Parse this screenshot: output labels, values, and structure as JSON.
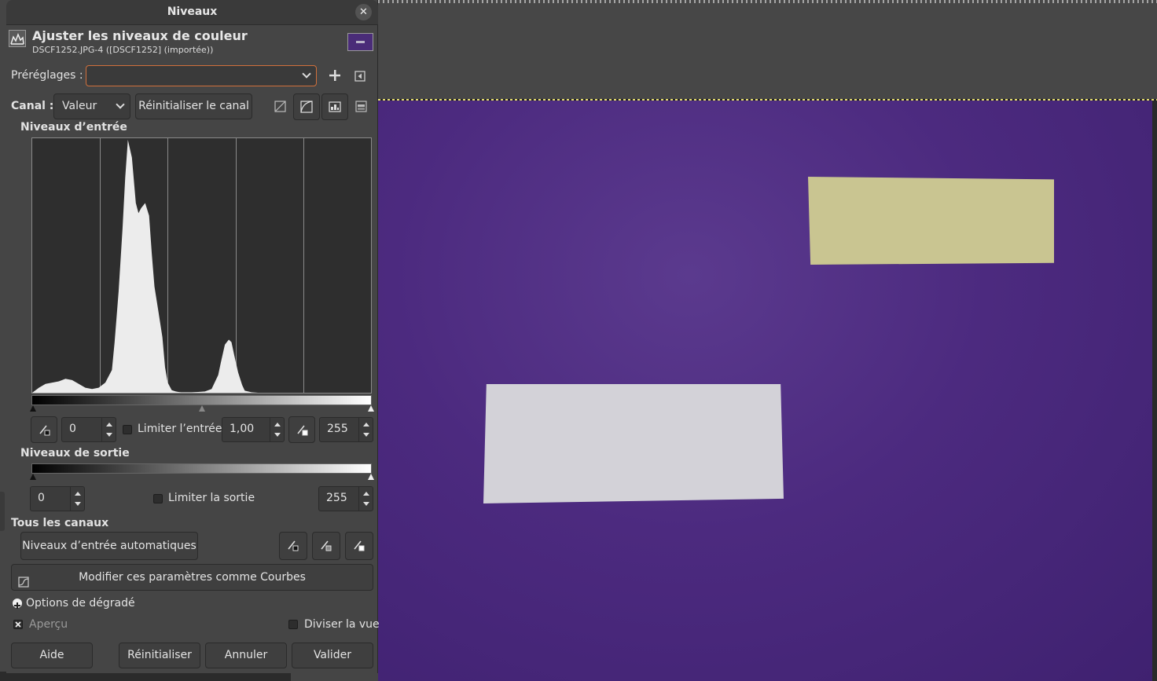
{
  "dialog": {
    "window_title": "Niveaux",
    "header_title": "Ajuster les niveaux de couleur",
    "header_subtitle": "DSCF1252.JPG-4 ([DSCF1252] (importée))"
  },
  "presets": {
    "label": "Préréglages :",
    "value": ""
  },
  "channel": {
    "label": "Canal :",
    "value": "Valeur",
    "reset_label": "Réinitialiser le canal"
  },
  "input_levels": {
    "title": "Niveaux d’entrée",
    "low": "0",
    "gamma": "1,00",
    "high": "255",
    "clamp_label": "Limiter l’entrée"
  },
  "output_levels": {
    "title": "Niveaux de sortie",
    "low": "0",
    "high": "255",
    "clamp_label": "Limiter la sortie"
  },
  "all_channels": {
    "title": "Tous les canaux",
    "auto_label": "Niveaux d’entrée automatiques"
  },
  "curves_label": "Modifier ces paramètres comme Courbes",
  "blend_options_label": "Options de dégradé",
  "preview": {
    "label": "Aperçu",
    "checked": true
  },
  "split_view": {
    "label": "Diviser la vue",
    "checked": false
  },
  "buttons": {
    "help": "Aide",
    "reset": "Réinitialiser",
    "cancel": "Annuler",
    "ok": "Valider"
  },
  "colors": {
    "canvas_background": "#4c2a7f",
    "dialog_background": "#454545",
    "focus_border": "#d0703c"
  },
  "chart_data": {
    "type": "area",
    "xlim": [
      0,
      255
    ],
    "ylim": [
      0,
      1
    ],
    "x": [
      0,
      5,
      10,
      15,
      20,
      25,
      30,
      35,
      40,
      45,
      50,
      55,
      60,
      62,
      65,
      68,
      70,
      72,
      75,
      78,
      80,
      82,
      85,
      88,
      90,
      92,
      95,
      98,
      100,
      102,
      105,
      108,
      110,
      112,
      115,
      118,
      120,
      125,
      130,
      135,
      140,
      142,
      145,
      148,
      150,
      152,
      155,
      158,
      160,
      165,
      170,
      200,
      230,
      255
    ],
    "values": [
      0.0,
      0.02,
      0.035,
      0.04,
      0.045,
      0.055,
      0.05,
      0.035,
      0.02,
      0.015,
      0.02,
      0.04,
      0.09,
      0.2,
      0.4,
      0.65,
      0.85,
      1.0,
      0.93,
      0.75,
      0.71,
      0.73,
      0.75,
      0.7,
      0.55,
      0.42,
      0.32,
      0.22,
      0.1,
      0.04,
      0.01,
      0.005,
      0.003,
      0.002,
      0.002,
      0.002,
      0.002,
      0.003,
      0.005,
      0.015,
      0.07,
      0.12,
      0.19,
      0.21,
      0.2,
      0.15,
      0.08,
      0.03,
      0.008,
      0.002,
      0.0,
      0.0,
      0.0,
      0.0
    ]
  }
}
